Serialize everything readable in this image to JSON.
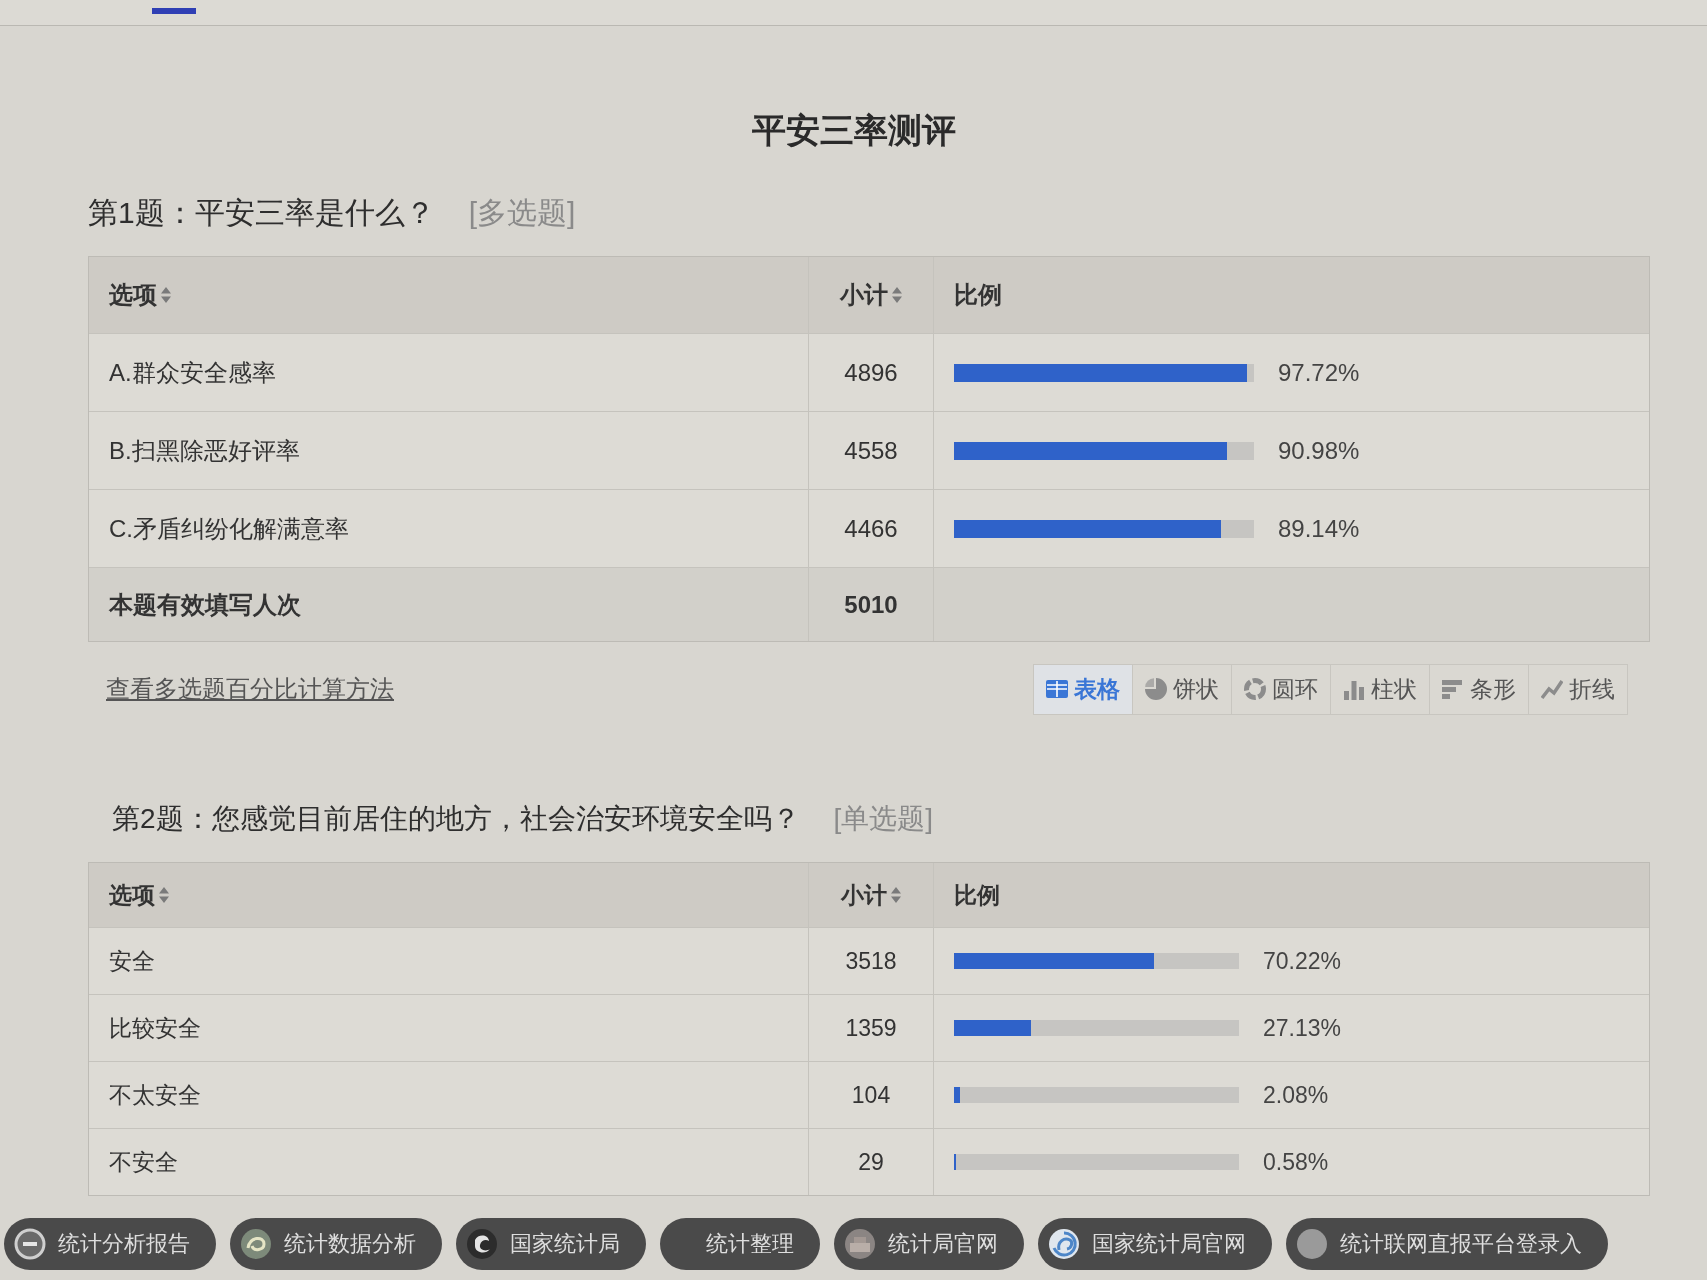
{
  "title": "平安三率测评",
  "questions": [
    {
      "heading": "第1题：平安三率是什么？",
      "type_tag": "[多选题]",
      "table": {
        "columns": [
          {
            "label": "选项",
            "sortable": true
          },
          {
            "label": "小计",
            "sortable": true
          },
          {
            "label": "比例",
            "sortable": false
          }
        ],
        "rows": [
          {
            "option": "A.群众安全感率",
            "count": "4896",
            "level": 0.9772,
            "percent": "97.72%"
          },
          {
            "option": "B.扫黑除恶好评率",
            "count": "4558",
            "level": 0.9098,
            "percent": "90.98%"
          },
          {
            "option": "C.矛盾纠纷化解满意率",
            "count": "4466",
            "level": 0.8914,
            "percent": "89.14%"
          }
        ],
        "total": {
          "label": "本题有效填写人次",
          "count": "5010"
        }
      },
      "method_link": "查看多选题百分比计算方法",
      "view_buttons": [
        {
          "label": "表格",
          "kind": "table",
          "selected": true
        },
        {
          "label": "饼状",
          "kind": "pie",
          "selected": false
        },
        {
          "label": "圆环",
          "kind": "donut",
          "selected": false
        },
        {
          "label": "柱状",
          "kind": "column",
          "selected": false
        },
        {
          "label": "条形",
          "kind": "bar",
          "selected": false
        },
        {
          "label": "折线",
          "kind": "line",
          "selected": false
        }
      ]
    },
    {
      "heading": "第2题：您感觉目前居住的地方，社会治安环境安全吗？",
      "type_tag": "[单选题]",
      "table": {
        "columns": [
          {
            "label": "选项",
            "sortable": true
          },
          {
            "label": "小计",
            "sortable": true
          },
          {
            "label": "比例",
            "sortable": false
          }
        ],
        "rows": [
          {
            "option": "安全",
            "count": "3518",
            "level": 0.7022,
            "percent": "70.22%"
          },
          {
            "option": "比较安全",
            "count": "1359",
            "level": 0.2713,
            "percent": "27.13%"
          },
          {
            "option": "不太安全",
            "count": "104",
            "level": 0.0208,
            "percent": "2.08%"
          },
          {
            "option": "不安全",
            "count": "29",
            "level": 0.0058,
            "percent": "0.58%"
          }
        ]
      }
    }
  ],
  "bottom_bar": [
    {
      "label": "统计分析报告",
      "kind": "ring"
    },
    {
      "label": "统计数据分析",
      "kind": "swirl"
    },
    {
      "label": "国家统计局",
      "kind": "emblem"
    },
    {
      "label": "统计整理",
      "kind": "plain"
    },
    {
      "label": "统计局官网",
      "kind": "photo"
    },
    {
      "label": "国家统计局官网",
      "kind": "globe"
    },
    {
      "label": "统计联网直报平台登录入",
      "kind": "disc"
    }
  ]
}
